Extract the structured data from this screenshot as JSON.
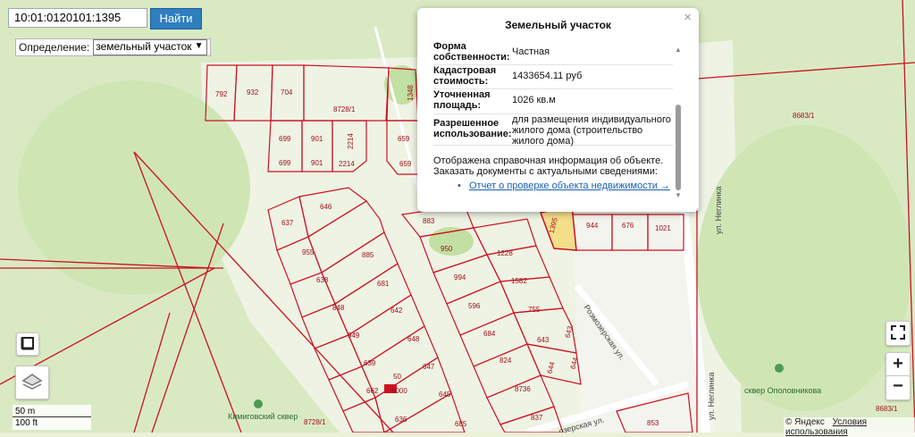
{
  "search": {
    "value": "10:01:0120101:1395",
    "button": "Найти"
  },
  "definition": {
    "label": "Определение:",
    "selected": "земельный участок"
  },
  "popup": {
    "title": "Земельный участок",
    "close": "×",
    "rows": [
      {
        "key": "Форма собственности:",
        "value": "Частная"
      },
      {
        "key": "Кадастровая стоимость:",
        "value": "1433654.11 руб"
      },
      {
        "key": "Уточненная площадь:",
        "value": "1026 кв.м"
      },
      {
        "key": "Разрешенное использование:",
        "value": "для размещения индивидуального жилого дома (строительство жилого дома)"
      }
    ],
    "note": "Отображена справочная информация об объекте. Заказать документы с актуальными сведениями:",
    "link": "Отчет о проверке объекта недвижимости →"
  },
  "map": {
    "parcels": [
      "792",
      "932",
      "704",
      "8728/1",
      "699",
      "901",
      "2214",
      "699",
      "901",
      "2214",
      "1348",
      "659",
      "659",
      "8683/1",
      "883",
      "950",
      "944",
      "676",
      "1021",
      "637",
      "646",
      "955",
      "885",
      "1228",
      "638",
      "681",
      "994",
      "1582",
      "848",
      "642",
      "596",
      "755",
      "949",
      "648",
      "684",
      "643",
      "639",
      "647",
      "824",
      "643",
      "644",
      "644",
      "662",
      "9000",
      "50",
      "645",
      "8736",
      "636",
      "685",
      "837",
      "853",
      "8728/1",
      "8683/1",
      "1395"
    ],
    "streets": [
      "ул. Неглинка",
      "Розмозерская ул.",
      "ул. Неглинка",
      "озерская ул."
    ],
    "pois": [
      "Кимиговский сквер",
      "сквер Ополовникова"
    ]
  },
  "controls": {
    "zoom_in": "+",
    "zoom_out": "−"
  },
  "scale": {
    "metric": "50 m",
    "imperial": "100 ft"
  },
  "copyright": {
    "provider": "© Яндекс",
    "terms": "Условия использования"
  },
  "colors": {
    "parcel_line": "#cc1122",
    "selected_fill": "#f3de8a",
    "water": "#b7d3f0",
    "road": "#ffffff",
    "forest": "#cfe6b4",
    "button": "#2f7fbf"
  }
}
